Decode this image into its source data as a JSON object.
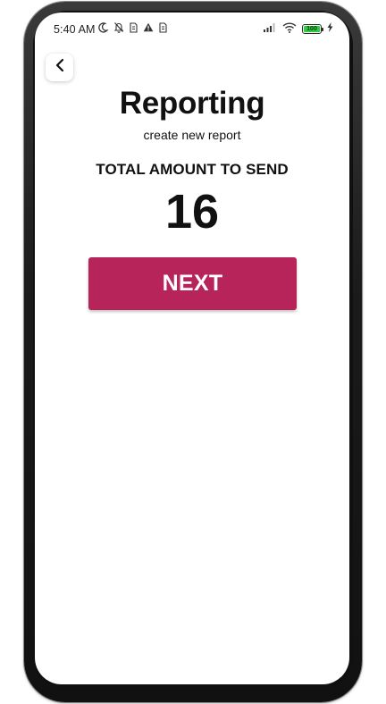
{
  "status_bar": {
    "time": "5:40 AM",
    "battery_level": "100"
  },
  "header": {
    "title": "Reporting",
    "subtitle": "create new report"
  },
  "main": {
    "total_label": "TOTAL AMOUNT TO SEND",
    "total_value": "16",
    "next_label": "NEXT"
  },
  "colors": {
    "accent": "#b6245a",
    "battery": "#2ecc40"
  }
}
